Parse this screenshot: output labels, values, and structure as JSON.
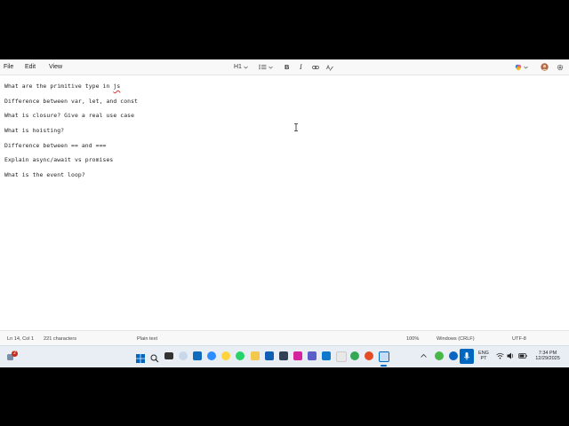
{
  "menu": {
    "file": "File",
    "edit": "Edit",
    "view": "View"
  },
  "toolbar": {
    "heading": "H1",
    "bold": "B",
    "italic": "I"
  },
  "document": {
    "lines": [
      {
        "before": "What are the primitive type in ",
        "misspelled": "js"
      },
      {
        "before": "Difference between var, let, and const",
        "misspelled": ""
      },
      {
        "before": "What is closure? Give a real use case",
        "misspelled": ""
      },
      {
        "before": "What is hoisting?",
        "misspelled": ""
      },
      {
        "before": "Difference between == and ===",
        "misspelled": ""
      },
      {
        "before": "Explain async/await vs promises",
        "misspelled": ""
      },
      {
        "before": "What is the event loop?",
        "misspelled": ""
      }
    ]
  },
  "status": {
    "position": "Ln 14, Col 1",
    "characters": "221 characters",
    "format": "Plain text",
    "zoom": "100%",
    "line_ending": "Windows (CRLF)",
    "encoding": "UTF-8"
  },
  "taskbar": {
    "notification_count": "2",
    "language": "ENG",
    "language_sub": "PT",
    "time": "7:34 PM",
    "date": "12/29/2025"
  },
  "colors": {
    "accent": "#0067c0",
    "spell_underline": "#d13438"
  }
}
